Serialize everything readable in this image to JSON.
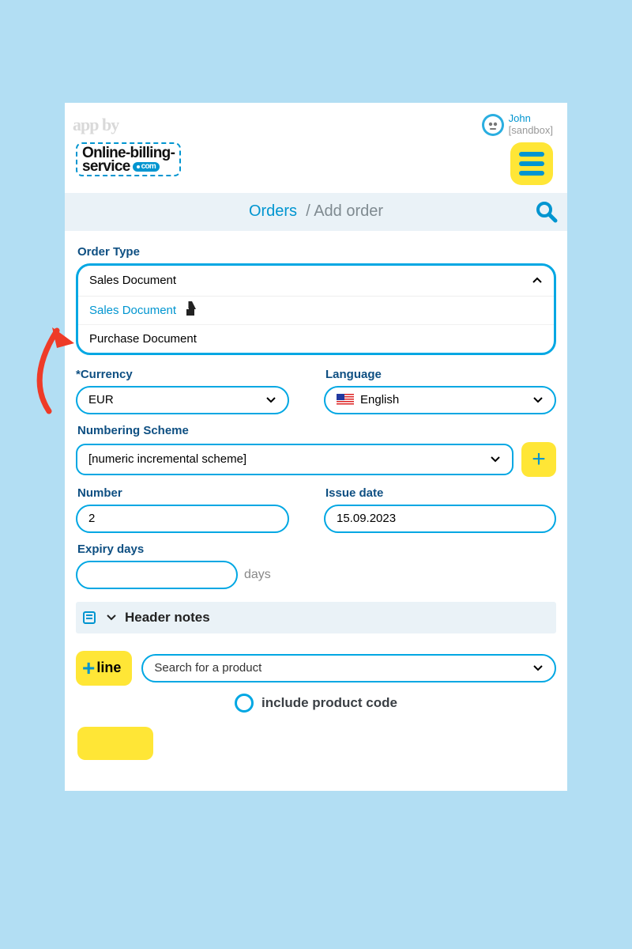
{
  "header": {
    "appby": "app by",
    "logo_line1": "Online-billing-",
    "logo_line2": "service",
    "logo_tld": "com",
    "user": {
      "name": "John",
      "env": "[sandbox]"
    }
  },
  "breadcrumb": {
    "link": "Orders",
    "sep": "/",
    "current": "Add order"
  },
  "form": {
    "order_type": {
      "label": "Order Type",
      "selected": "Sales Document",
      "options": [
        "Sales Document",
        "Purchase Document"
      ]
    },
    "currency": {
      "label_prefix": "*",
      "label": "Currency",
      "value": "EUR"
    },
    "language": {
      "label": "Language",
      "value": "English"
    },
    "scheme": {
      "label": "Numbering Scheme",
      "value": "[numeric incremental scheme]"
    },
    "number": {
      "label": "Number",
      "value": "2"
    },
    "issue_date": {
      "label": "Issue date",
      "value": "15.09.2023"
    },
    "expiry": {
      "label": "Expiry days",
      "suffix": "days",
      "value": ""
    },
    "header_notes": "Header notes",
    "add_line": "line",
    "product_search_placeholder": "Search for a product",
    "include_product_code": "include product code"
  }
}
